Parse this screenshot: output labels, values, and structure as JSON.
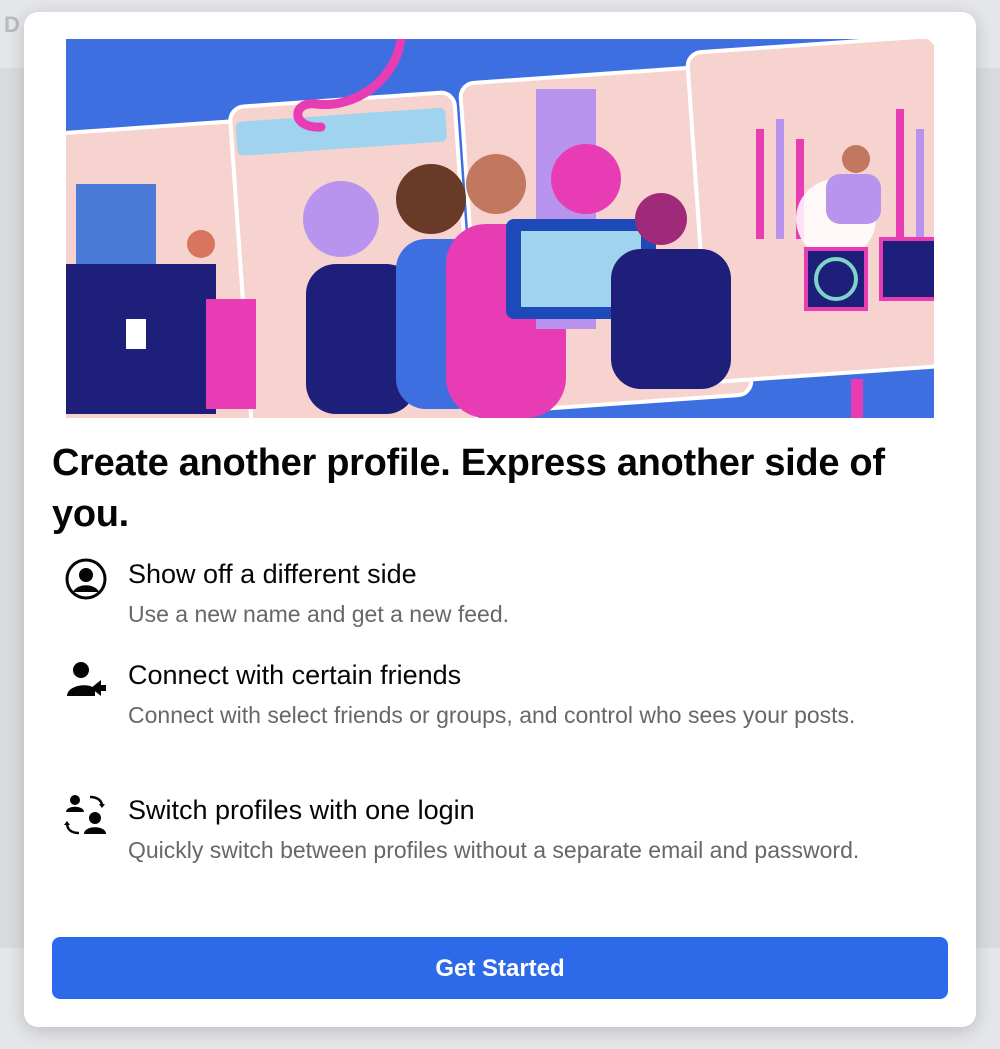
{
  "backdrop": {
    "text": "D"
  },
  "modal": {
    "title": "Create another profile. Express another side of you.",
    "features": [
      {
        "icon": "profile-circle-icon",
        "heading": "Show off a different side",
        "description": "Use a new name and get a new feed."
      },
      {
        "icon": "person-share-icon",
        "heading": "Connect with certain friends",
        "description": "Connect with select friends or groups, and control who sees your posts."
      },
      {
        "icon": "switch-profiles-icon",
        "heading": "Switch profiles with one login",
        "description": "Quickly switch between profiles without a separate email and password."
      }
    ],
    "cta_label": "Get Started"
  },
  "colors": {
    "accent": "#2d6ae9",
    "hero_blue": "#3d6fe0",
    "hero_pink": "#f7d3d0",
    "hero_magenta": "#e83cb4",
    "hero_navy": "#1d1f7a"
  }
}
